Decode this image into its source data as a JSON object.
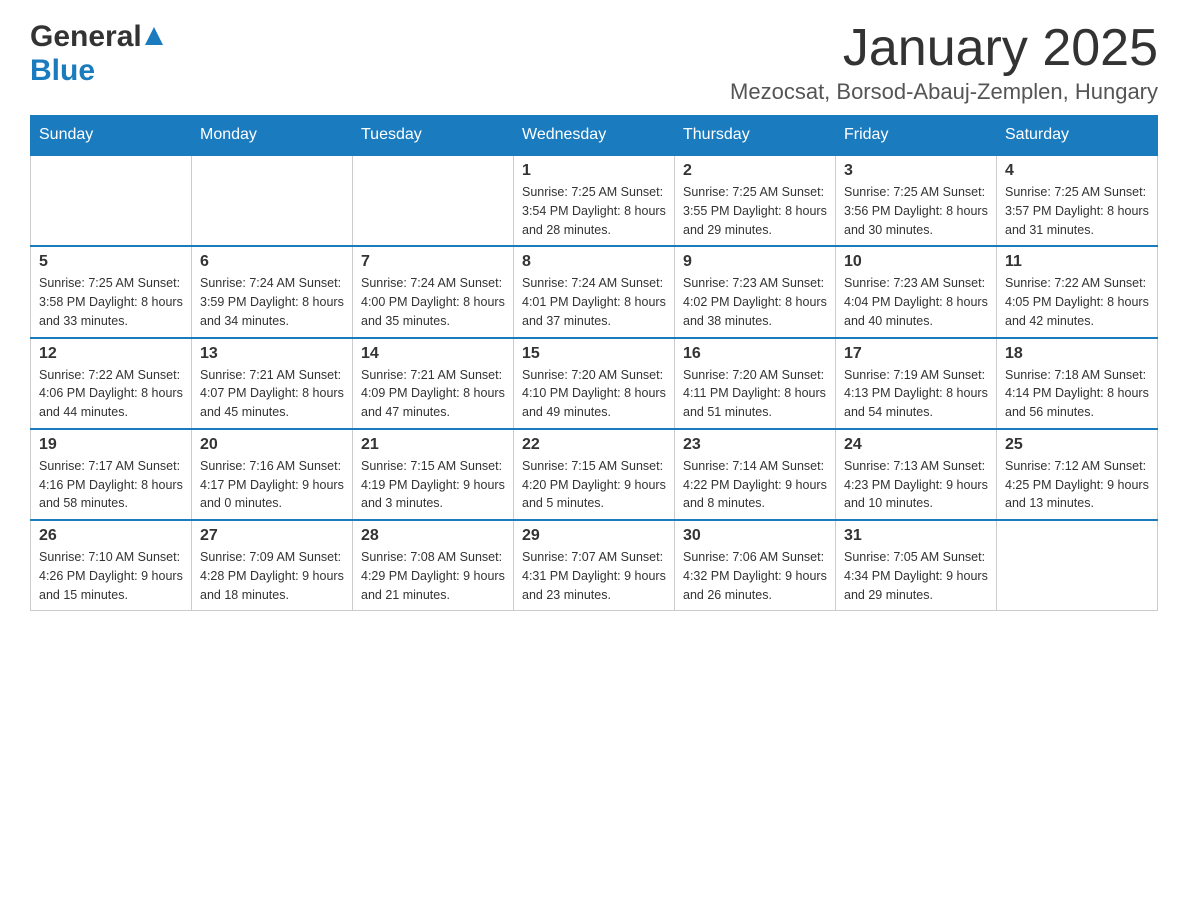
{
  "header": {
    "logo_general": "General",
    "logo_blue": "Blue",
    "month_title": "January 2025",
    "location": "Mezocsat, Borsod-Abauj-Zemplen, Hungary"
  },
  "weekdays": [
    "Sunday",
    "Monday",
    "Tuesday",
    "Wednesday",
    "Thursday",
    "Friday",
    "Saturday"
  ],
  "weeks": [
    [
      {
        "day": "",
        "info": ""
      },
      {
        "day": "",
        "info": ""
      },
      {
        "day": "",
        "info": ""
      },
      {
        "day": "1",
        "info": "Sunrise: 7:25 AM\nSunset: 3:54 PM\nDaylight: 8 hours\nand 28 minutes."
      },
      {
        "day": "2",
        "info": "Sunrise: 7:25 AM\nSunset: 3:55 PM\nDaylight: 8 hours\nand 29 minutes."
      },
      {
        "day": "3",
        "info": "Sunrise: 7:25 AM\nSunset: 3:56 PM\nDaylight: 8 hours\nand 30 minutes."
      },
      {
        "day": "4",
        "info": "Sunrise: 7:25 AM\nSunset: 3:57 PM\nDaylight: 8 hours\nand 31 minutes."
      }
    ],
    [
      {
        "day": "5",
        "info": "Sunrise: 7:25 AM\nSunset: 3:58 PM\nDaylight: 8 hours\nand 33 minutes."
      },
      {
        "day": "6",
        "info": "Sunrise: 7:24 AM\nSunset: 3:59 PM\nDaylight: 8 hours\nand 34 minutes."
      },
      {
        "day": "7",
        "info": "Sunrise: 7:24 AM\nSunset: 4:00 PM\nDaylight: 8 hours\nand 35 minutes."
      },
      {
        "day": "8",
        "info": "Sunrise: 7:24 AM\nSunset: 4:01 PM\nDaylight: 8 hours\nand 37 minutes."
      },
      {
        "day": "9",
        "info": "Sunrise: 7:23 AM\nSunset: 4:02 PM\nDaylight: 8 hours\nand 38 minutes."
      },
      {
        "day": "10",
        "info": "Sunrise: 7:23 AM\nSunset: 4:04 PM\nDaylight: 8 hours\nand 40 minutes."
      },
      {
        "day": "11",
        "info": "Sunrise: 7:22 AM\nSunset: 4:05 PM\nDaylight: 8 hours\nand 42 minutes."
      }
    ],
    [
      {
        "day": "12",
        "info": "Sunrise: 7:22 AM\nSunset: 4:06 PM\nDaylight: 8 hours\nand 44 minutes."
      },
      {
        "day": "13",
        "info": "Sunrise: 7:21 AM\nSunset: 4:07 PM\nDaylight: 8 hours\nand 45 minutes."
      },
      {
        "day": "14",
        "info": "Sunrise: 7:21 AM\nSunset: 4:09 PM\nDaylight: 8 hours\nand 47 minutes."
      },
      {
        "day": "15",
        "info": "Sunrise: 7:20 AM\nSunset: 4:10 PM\nDaylight: 8 hours\nand 49 minutes."
      },
      {
        "day": "16",
        "info": "Sunrise: 7:20 AM\nSunset: 4:11 PM\nDaylight: 8 hours\nand 51 minutes."
      },
      {
        "day": "17",
        "info": "Sunrise: 7:19 AM\nSunset: 4:13 PM\nDaylight: 8 hours\nand 54 minutes."
      },
      {
        "day": "18",
        "info": "Sunrise: 7:18 AM\nSunset: 4:14 PM\nDaylight: 8 hours\nand 56 minutes."
      }
    ],
    [
      {
        "day": "19",
        "info": "Sunrise: 7:17 AM\nSunset: 4:16 PM\nDaylight: 8 hours\nand 58 minutes."
      },
      {
        "day": "20",
        "info": "Sunrise: 7:16 AM\nSunset: 4:17 PM\nDaylight: 9 hours\nand 0 minutes."
      },
      {
        "day": "21",
        "info": "Sunrise: 7:15 AM\nSunset: 4:19 PM\nDaylight: 9 hours\nand 3 minutes."
      },
      {
        "day": "22",
        "info": "Sunrise: 7:15 AM\nSunset: 4:20 PM\nDaylight: 9 hours\nand 5 minutes."
      },
      {
        "day": "23",
        "info": "Sunrise: 7:14 AM\nSunset: 4:22 PM\nDaylight: 9 hours\nand 8 minutes."
      },
      {
        "day": "24",
        "info": "Sunrise: 7:13 AM\nSunset: 4:23 PM\nDaylight: 9 hours\nand 10 minutes."
      },
      {
        "day": "25",
        "info": "Sunrise: 7:12 AM\nSunset: 4:25 PM\nDaylight: 9 hours\nand 13 minutes."
      }
    ],
    [
      {
        "day": "26",
        "info": "Sunrise: 7:10 AM\nSunset: 4:26 PM\nDaylight: 9 hours\nand 15 minutes."
      },
      {
        "day": "27",
        "info": "Sunrise: 7:09 AM\nSunset: 4:28 PM\nDaylight: 9 hours\nand 18 minutes."
      },
      {
        "day": "28",
        "info": "Sunrise: 7:08 AM\nSunset: 4:29 PM\nDaylight: 9 hours\nand 21 minutes."
      },
      {
        "day": "29",
        "info": "Sunrise: 7:07 AM\nSunset: 4:31 PM\nDaylight: 9 hours\nand 23 minutes."
      },
      {
        "day": "30",
        "info": "Sunrise: 7:06 AM\nSunset: 4:32 PM\nDaylight: 9 hours\nand 26 minutes."
      },
      {
        "day": "31",
        "info": "Sunrise: 7:05 AM\nSunset: 4:34 PM\nDaylight: 9 hours\nand 29 minutes."
      },
      {
        "day": "",
        "info": ""
      }
    ]
  ]
}
